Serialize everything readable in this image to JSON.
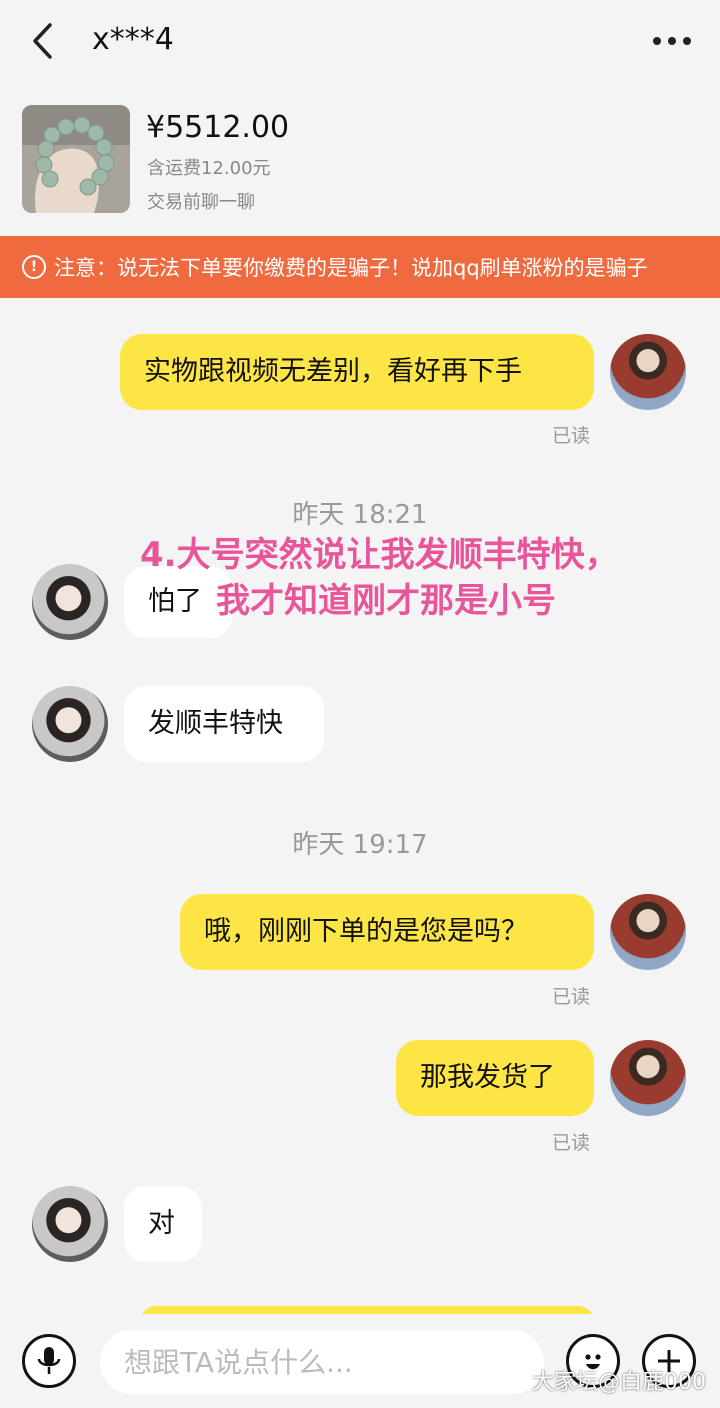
{
  "header": {
    "title": "x***4",
    "back_icon": "chevron-left-icon",
    "more_icon": "more-dots-icon"
  },
  "product": {
    "price": "¥5512.00",
    "shipping": "含运费12.00元",
    "pretalk": "交易前聊一聊"
  },
  "warning": {
    "text": "注意：说无法下单要你缴费的是骗子！说加qq刷单涨粉的是骗子",
    "color": "#ef6a3f"
  },
  "messages": [
    {
      "text": "实物跟视频无差别，看好再下手",
      "status": "已读"
    },
    {
      "time": "昨天 18:21"
    },
    {
      "text": "怕了"
    },
    {
      "text": "发顺丰特快"
    },
    {
      "time": "昨天 19:17"
    },
    {
      "text": "哦，刚刚下单的是您是吗？",
      "status": "已读"
    },
    {
      "text": "那我发货了",
      "status": "已读"
    },
    {
      "text": "对"
    }
  ],
  "annotation": {
    "line1": "4.大号突然说让我发顺丰特快，",
    "line2": "我才知道刚才那是小号",
    "color": "#e8559a"
  },
  "input": {
    "placeholder": "想跟TA说点什么..."
  },
  "watermark": "大家坛@白鹿000",
  "colors": {
    "my_bubble": "#fde545",
    "their_bubble": "#ffffff",
    "background": "#f4f4f4"
  }
}
